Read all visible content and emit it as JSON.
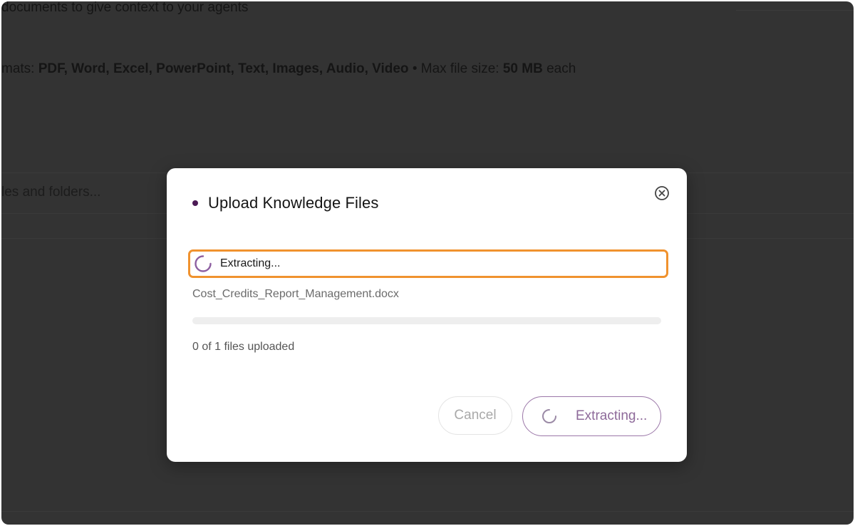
{
  "background": {
    "description_fragment": "documents to give context to your agents",
    "formats_prefix": "mats:",
    "formats_list": "PDF, Word, Excel, PowerPoint, Text, Images, Audio, Video",
    "separator": "•",
    "max_size_label": "Max file size:",
    "max_size_value": "50 MB",
    "max_size_suffix": "each",
    "search_placeholder_fragment": "les and folders..."
  },
  "modal": {
    "title": "Upload Knowledge Files",
    "status_text": "Extracting...",
    "file_name": "Cost_Credits_Report_Management.docx",
    "progress_percent": 0,
    "upload_count_text": "0 of 1 files uploaded",
    "cancel_label": "Cancel",
    "primary_label": "Extracting..."
  },
  "colors": {
    "accent": "#8e6a9a",
    "highlight": "#f0922e",
    "title_dot": "#4b1a55"
  },
  "icons": {
    "close": "close-circle-icon",
    "spinner": "spinner-icon"
  }
}
